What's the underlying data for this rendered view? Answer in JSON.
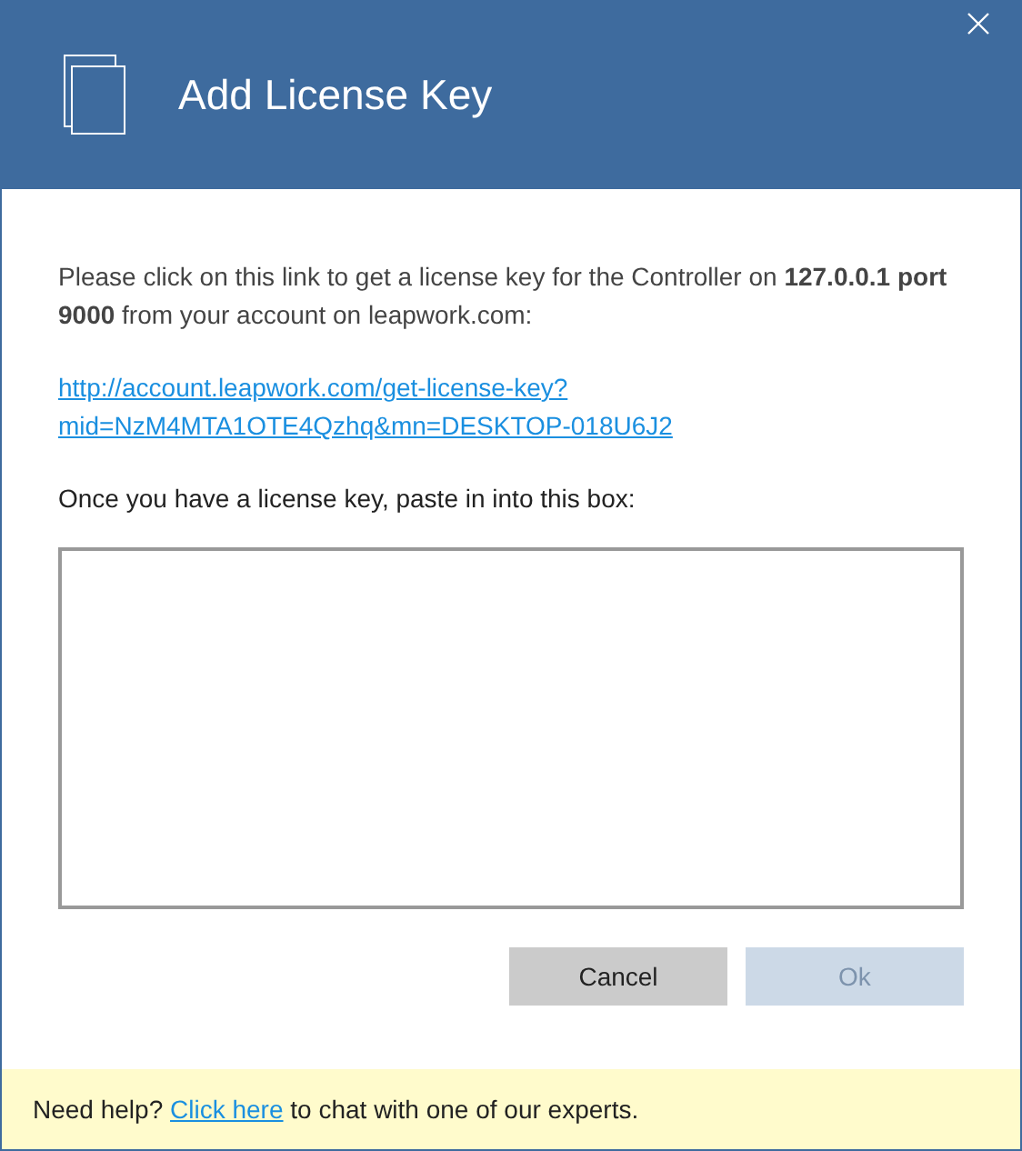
{
  "window": {
    "title": "Add License Key"
  },
  "message": "Please click on this link to get a license key for the Controller on **127.0.0.1 port 9000** from your account on leapwork.com:",
  "license_link": {
    "lines": [
      "http://account.leapwork.com/get-license-key?",
      "mid=NzM4MTA1OTE4Qzhq&mn=DESKTOP-018U6J2"
    ]
  },
  "key_prompt": "Once you have a license key, paste in into this box:",
  "buttons": [
    {
      "label": "Cancel",
      "disabled": false
    },
    {
      "label": "Ok",
      "disabled": true
    }
  ],
  "footer": {
    "prefix": "Need help?",
    "link": "Click here",
    "suffix": "to chat with one of our experts."
  }
}
